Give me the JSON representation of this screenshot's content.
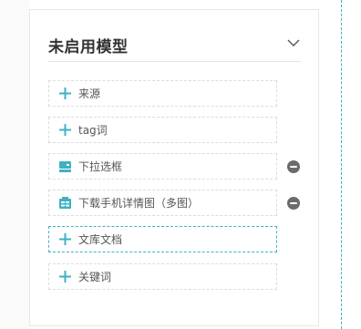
{
  "panel": {
    "title": "未启用模型",
    "collapse_icon": "chevron-down-icon"
  },
  "fields": [
    {
      "label": "来源",
      "icon": "plus-icon",
      "removable": false,
      "active": false
    },
    {
      "label": "tag词",
      "icon": "plus-icon",
      "removable": false,
      "active": false
    },
    {
      "label": "下拉选框",
      "icon": "dropdown-icon",
      "removable": true,
      "active": false
    },
    {
      "label": "下载手机详情图（多图）",
      "icon": "image-gallery-icon",
      "removable": true,
      "active": false
    },
    {
      "label": "文库文档",
      "icon": "plus-icon",
      "removable": false,
      "active": true
    },
    {
      "label": "关键词",
      "icon": "plus-icon",
      "removable": false,
      "active": false
    }
  ],
  "colors": {
    "accent": "#3fb1c3",
    "remove": "#6b6b6b",
    "title": "#333333"
  }
}
